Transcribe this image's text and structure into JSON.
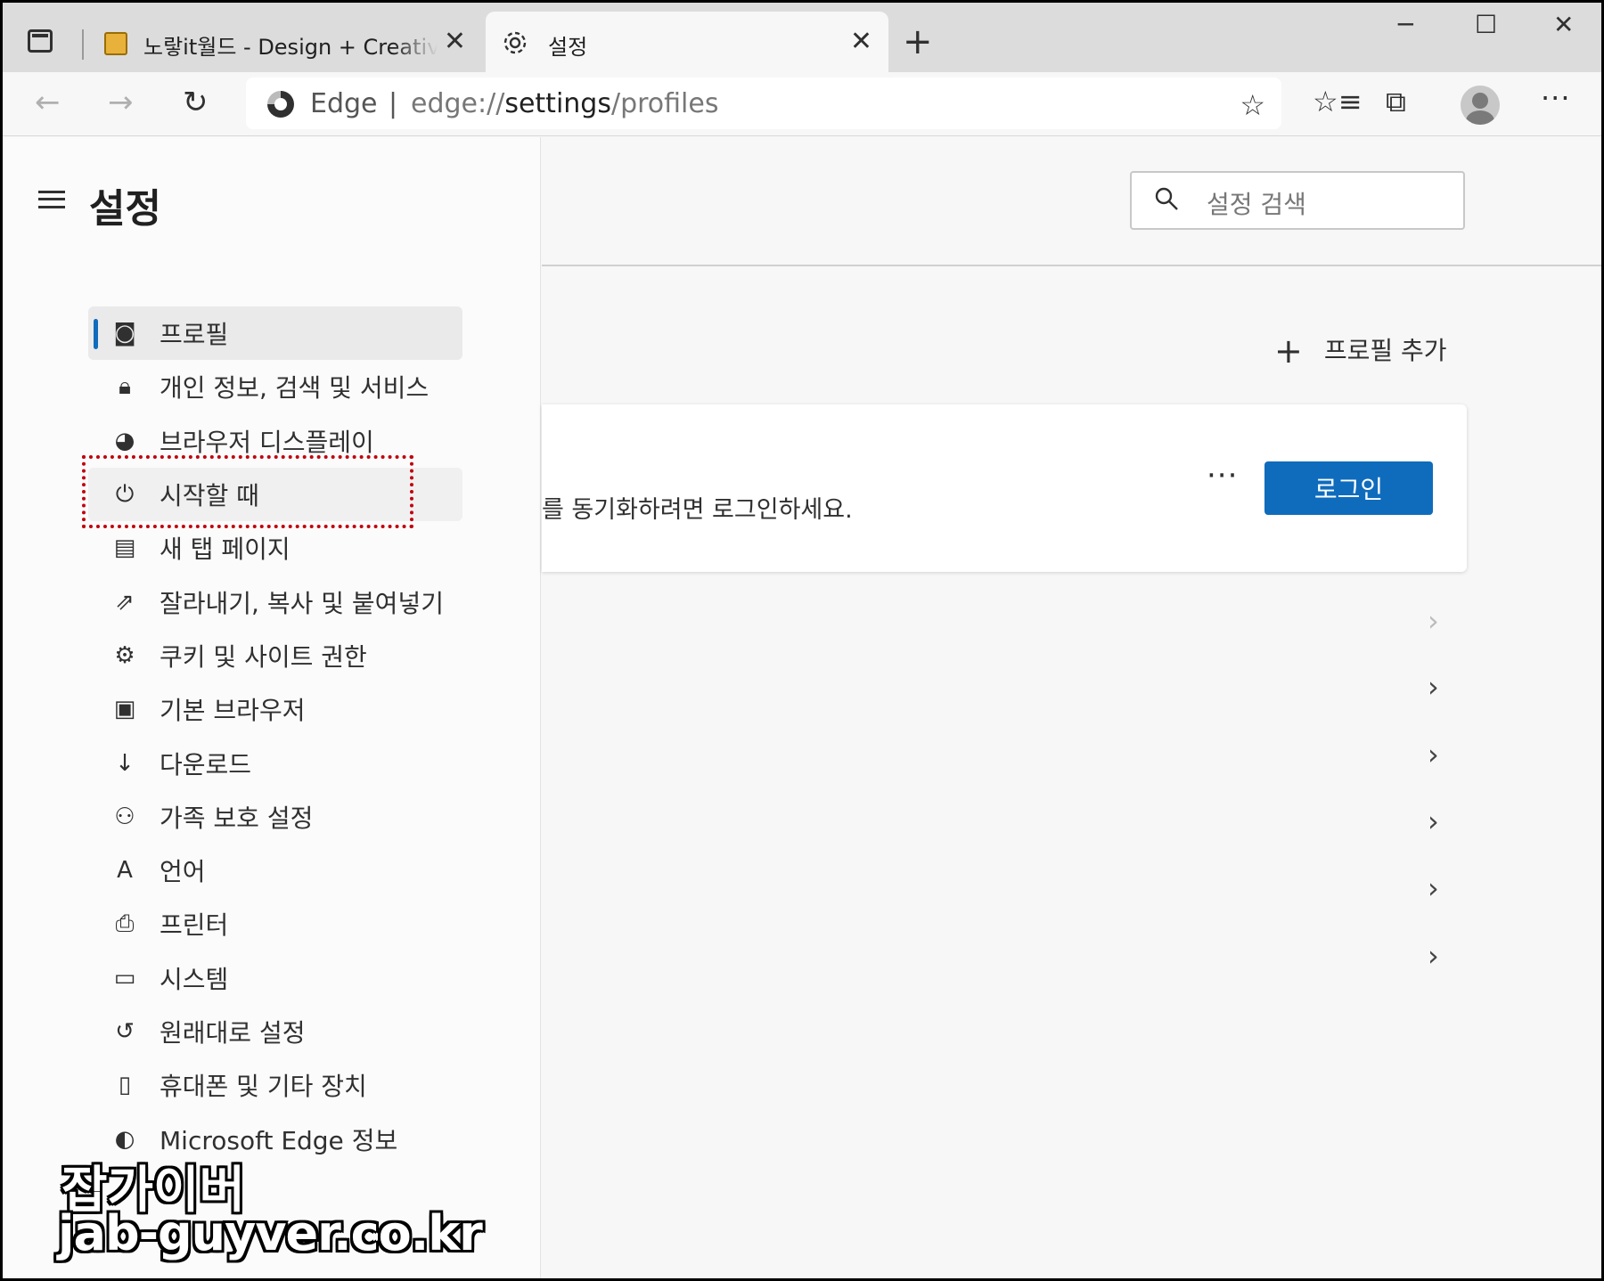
{
  "tabs": {
    "inactive_title": "노랗it월드 - Design + Creative + IT",
    "active_title": "설정",
    "close": "✕",
    "new_tab": "+"
  },
  "window": {
    "minimize": "─",
    "maximize": "☐",
    "close": "✕"
  },
  "toolbar": {
    "back": "←",
    "forward": "→",
    "refresh": "↻",
    "brand": "Edge",
    "separator": "|",
    "url_scheme": "edge://",
    "url_host": "settings",
    "url_path": "/profiles",
    "favorites_add_icon": "☆",
    "favorites_icon": "☆≡",
    "collections_icon": "⧉",
    "more": "···"
  },
  "sidebar": {
    "title": "설정",
    "items": [
      {
        "label": "프로필",
        "icon": "profile-icon",
        "glyph": "◙"
      },
      {
        "label": "개인 정보, 검색 및 서비스",
        "icon": "lock-icon",
        "glyph": "🔒︎"
      },
      {
        "label": "브라우저 디스플레이",
        "icon": "palette-icon",
        "glyph": "◕"
      },
      {
        "label": "시작할 때",
        "icon": "power-icon",
        "glyph": "⏻"
      },
      {
        "label": "새 탭 페이지",
        "icon": "new-tab-page-icon",
        "glyph": "▤"
      },
      {
        "label": "잘라내기, 복사 및 붙여넣기",
        "icon": "share-icon",
        "glyph": "⇗"
      },
      {
        "label": "쿠키 및 사이트 권한",
        "icon": "cookie-settings-icon",
        "glyph": "⚙"
      },
      {
        "label": "기본 브라우저",
        "icon": "default-browser-icon",
        "glyph": "▣"
      },
      {
        "label": "다운로드",
        "icon": "download-icon",
        "glyph": "↓"
      },
      {
        "label": "가족 보호 설정",
        "icon": "family-icon",
        "glyph": "⚇"
      },
      {
        "label": "언어",
        "icon": "language-icon",
        "glyph": "A"
      },
      {
        "label": "프린터",
        "icon": "printer-icon",
        "glyph": "⎙"
      },
      {
        "label": "시스템",
        "icon": "laptop-icon",
        "glyph": "▭"
      },
      {
        "label": "원래대로 설정",
        "icon": "reset-icon",
        "glyph": "↺"
      },
      {
        "label": "휴대폰 및 기타 장치",
        "icon": "phone-icon",
        "glyph": "▯"
      },
      {
        "label": "Microsoft Edge 정보",
        "icon": "edge-logo-icon",
        "glyph": "◐"
      }
    ]
  },
  "main": {
    "search_placeholder": "설정 검색",
    "add_profile": "프로필 추가",
    "add_profile_plus": "+",
    "card_text": "를 동기화하려면 로그인하세요.",
    "card_more": "···",
    "login_button": "로그인",
    "chevron": "›"
  },
  "watermark": {
    "line1": "잡가이버",
    "line2": "jab-guyver.co.kr"
  },
  "colors": {
    "accent": "#0f6cbd",
    "highlight_border": "#c0000c"
  }
}
